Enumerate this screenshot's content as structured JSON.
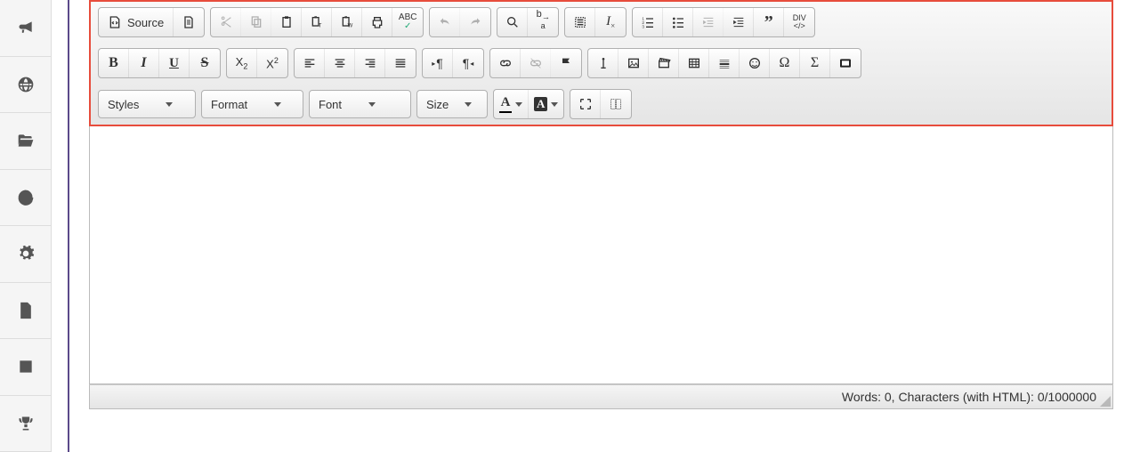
{
  "sidebar": {
    "items": [
      {
        "name": "announcements-icon"
      },
      {
        "name": "globe-icon"
      },
      {
        "name": "folder-icon"
      },
      {
        "name": "chart-icon"
      },
      {
        "name": "settings-icon"
      },
      {
        "name": "document-icon"
      },
      {
        "name": "calendar-icon"
      },
      {
        "name": "trophy-icon"
      }
    ]
  },
  "toolbar": {
    "source_label": "Source",
    "styles_label": "Styles",
    "format_label": "Format",
    "font_label": "Font",
    "size_label": "Size",
    "abc_label": "ABC",
    "div_label": "DIV"
  },
  "status": {
    "text": "Words: 0, Characters (with HTML): 0/1000000"
  }
}
